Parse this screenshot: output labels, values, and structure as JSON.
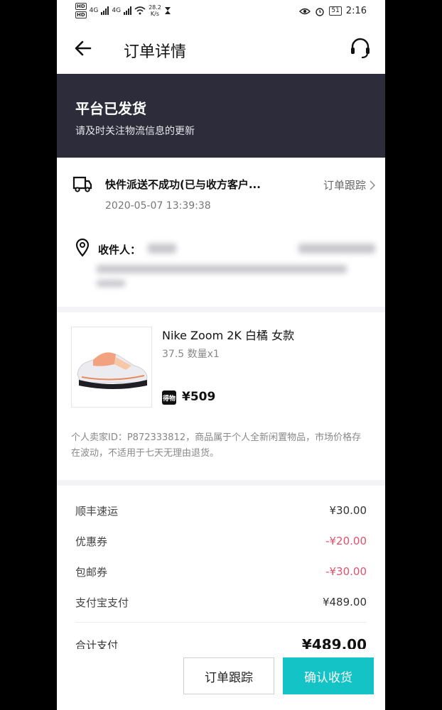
{
  "status_bar": {
    "hd1": "HD",
    "hd2": "HD",
    "net1": "4G",
    "net2": "4G",
    "speed": "28.2",
    "speed_unit": "K/s",
    "battery": "51",
    "time": "2:16"
  },
  "header": {
    "title": "订单详情"
  },
  "banner": {
    "title": "平台已发货",
    "subtitle": "请及时关注物流信息的更新"
  },
  "logistics": {
    "status_text": "快件派送不成功(已与收方客户...",
    "track_label": "订单跟踪",
    "time": "2020-05-07 13:39:38",
    "receiver_label": "收件人："
  },
  "product": {
    "name": "Nike Zoom 2K 白橘 女款",
    "spec": "37.5  数量x1",
    "platform_badge": "得物",
    "price": "¥509",
    "note": "个人卖家ID：P872333812，商品属于个人全新闲置物品，市场价格存在波动，不适用于七天无理由退货。"
  },
  "payment": {
    "rows": [
      {
        "label": "顺丰速运",
        "value": "¥30.00"
      },
      {
        "label": "优惠券",
        "value": "-¥20.00"
      },
      {
        "label": "包邮券",
        "value": "-¥30.00"
      },
      {
        "label": "支付宝支付",
        "value": "¥489.00"
      }
    ],
    "total_label": "合计支付",
    "total_value": "¥489.00"
  },
  "bottom_bar": {
    "track_button": "订单跟踪",
    "confirm_button": "确认收货"
  },
  "colors": {
    "banner_bg": "#2c2c3a",
    "accent": "#13c3c5",
    "discount": "#e0526a"
  }
}
